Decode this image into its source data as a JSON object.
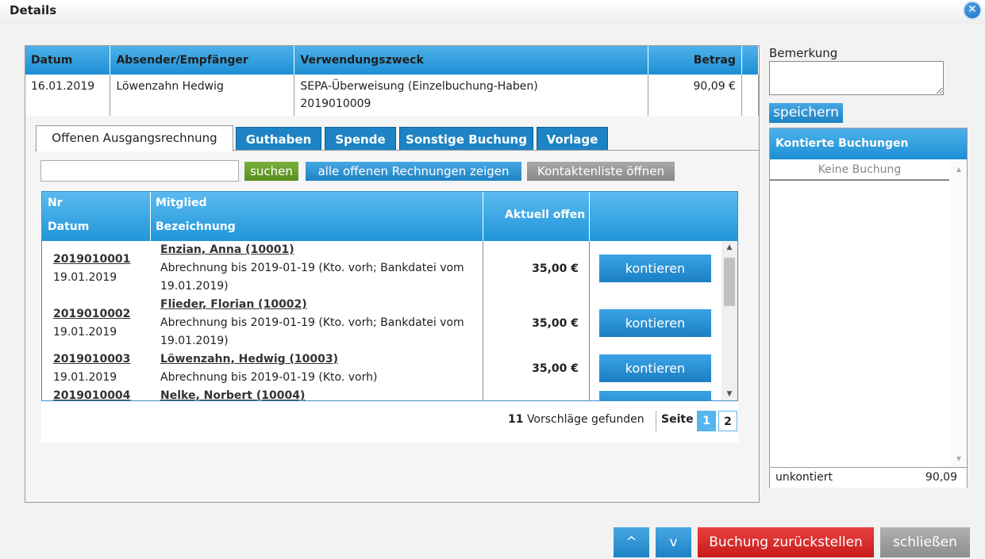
{
  "dialog": {
    "title": "Details",
    "close_symbol": "✕"
  },
  "booking": {
    "headers": {
      "datum": "Datum",
      "absender": "Absender/Empfänger",
      "zweck": "Verwendungszweck",
      "betrag": "Betrag"
    },
    "datum": "16.01.2019",
    "absender": "Löwenzahn Hedwig",
    "zweck_line1": "SEPA-Überweisung (Einzelbuchung-Haben)",
    "zweck_line2": "2019010009",
    "betrag": "90,09 €"
  },
  "tabs": [
    "Offenen Ausgangsrechnung",
    "Guthaben",
    "Spende",
    "Sonstige Buchung",
    "Vorlage"
  ],
  "search": {
    "value": "",
    "search_button": "suchen",
    "show_all_button": "alle offenen Rechnungen zeigen",
    "contacts_button": "Kontaktenliste öffnen"
  },
  "invoices": {
    "headers": {
      "nr": "Nr",
      "datum": "Datum",
      "mitglied": "Mitglied",
      "bezeichnung": "Bezeichnung",
      "offen": "Aktuell offen"
    },
    "rows": [
      {
        "nr": "2019010001",
        "datum": "19.01.2019",
        "mitglied": "Enzian, Anna (10001)",
        "bez1": "Abrechnung bis 2019-01-19 (Kto. vorh; Bankdatei vom",
        "bez2": "19.01.2019)",
        "offen": "35,00 €",
        "action": "kontieren"
      },
      {
        "nr": "2019010002",
        "datum": "19.01.2019",
        "mitglied": "Flieder, Florian (10002)",
        "bez1": "Abrechnung bis 2019-01-19 (Kto. vorh; Bankdatei vom",
        "bez2": "19.01.2019)",
        "offen": "35,00 €",
        "action": "kontieren"
      },
      {
        "nr": "2019010003",
        "datum": "19.01.2019",
        "mitglied": "Löwenzahn, Hedwig (10003)",
        "bez1": "Abrechnung bis 2019-01-19 (Kto. vorh)",
        "bez2": "",
        "offen": "35,00 €",
        "action": "kontieren"
      },
      {
        "nr": "2019010004",
        "datum": "",
        "mitglied": "Nelke, Norbert (10004)",
        "bez1": "",
        "bez2": "",
        "offen": "",
        "action": ""
      }
    ],
    "found_count": "11",
    "found_label": "Vorschläge gefunden",
    "page_label": "Seite",
    "pages": [
      "1",
      "2"
    ]
  },
  "remark": {
    "label": "Bemerkung",
    "value": "",
    "save_button": "speichern"
  },
  "kontierte": {
    "title": "Kontierte Buchungen",
    "empty": "Keine Buchung",
    "footer_label": "unkontiert",
    "footer_value": "90,09"
  },
  "bottom": {
    "up": "^",
    "down": "v",
    "reset": "Buchung zurückstellen",
    "close": "schließen"
  }
}
